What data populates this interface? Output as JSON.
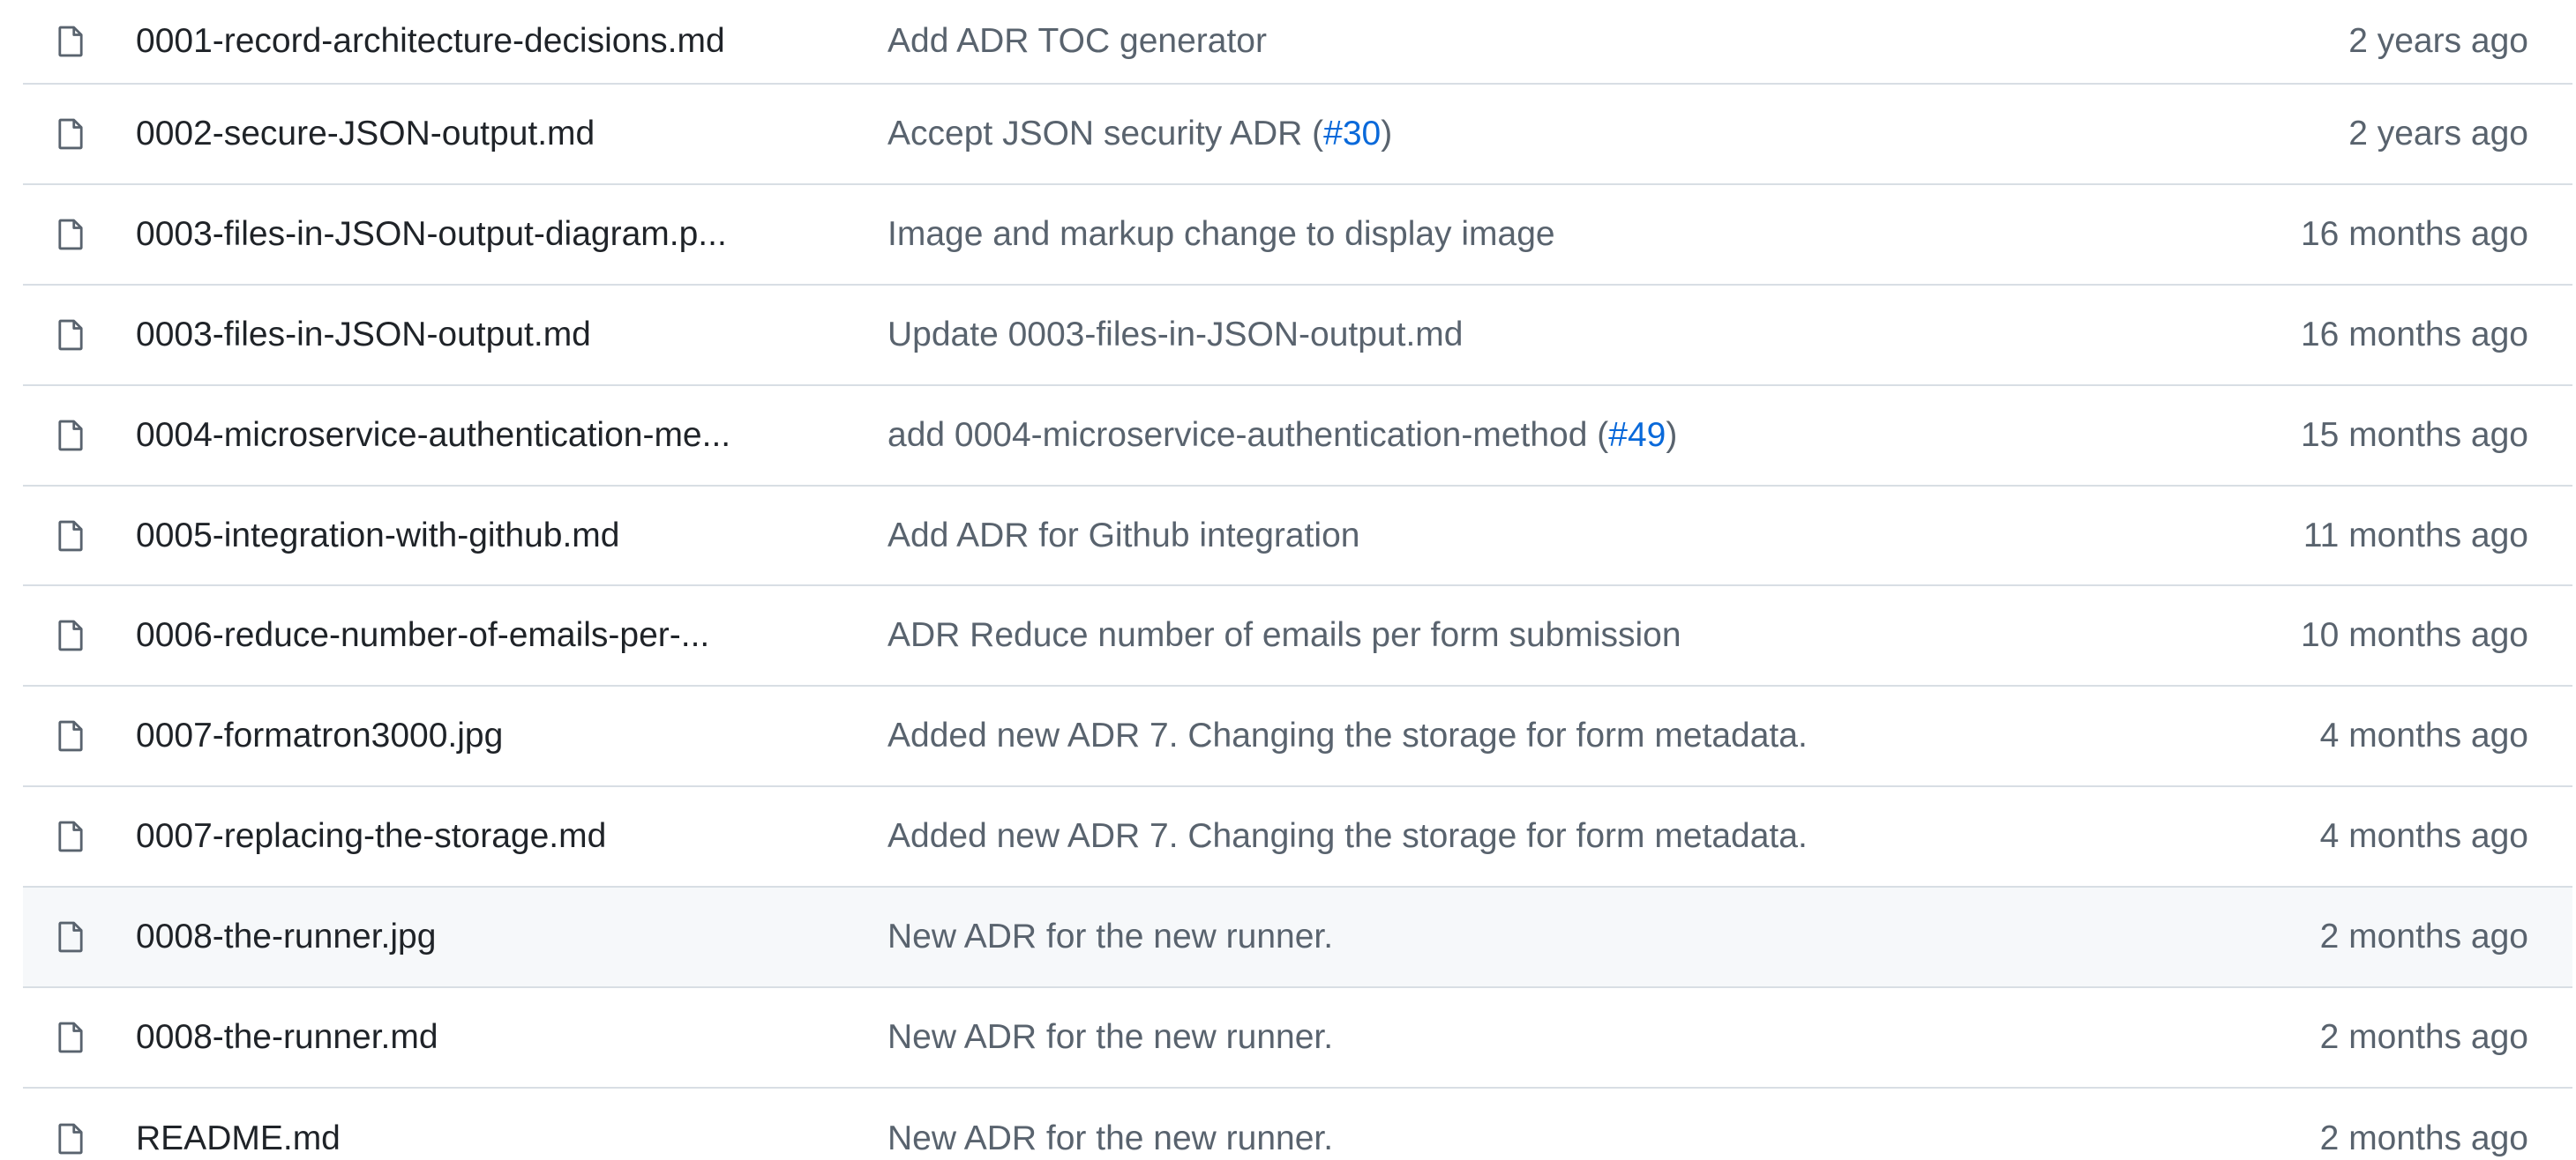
{
  "files": [
    {
      "icon": "file-icon",
      "name": "0001-record-architecture-decisions.md",
      "message": "Add ADR TOC generator",
      "pr": "",
      "message_suffix": "",
      "age": "2 years ago"
    },
    {
      "icon": "file-icon",
      "name": "0002-secure-JSON-output.md",
      "message": "Accept JSON security ADR (",
      "pr": "#30",
      "message_suffix": ")",
      "age": "2 years ago"
    },
    {
      "icon": "file-icon",
      "name": "0003-files-in-JSON-output-diagram.p...",
      "message": "Image and markup change to display image",
      "pr": "",
      "message_suffix": "",
      "age": "16 months ago"
    },
    {
      "icon": "file-icon",
      "name": "0003-files-in-JSON-output.md",
      "message": "Update 0003-files-in-JSON-output.md",
      "pr": "",
      "message_suffix": "",
      "age": "16 months ago"
    },
    {
      "icon": "file-icon",
      "name": "0004-microservice-authentication-me...",
      "message": "add 0004-microservice-authentication-method (",
      "pr": "#49",
      "message_suffix": ")",
      "age": "15 months ago"
    },
    {
      "icon": "file-icon",
      "name": "0005-integration-with-github.md",
      "message": "Add ADR for Github integration",
      "pr": "",
      "message_suffix": "",
      "age": "11 months ago"
    },
    {
      "icon": "file-icon",
      "name": "0006-reduce-number-of-emails-per-...",
      "message": "ADR Reduce number of emails per form submission",
      "pr": "",
      "message_suffix": "",
      "age": "10 months ago"
    },
    {
      "icon": "file-icon",
      "name": "0007-formatron3000.jpg",
      "message": "Added new ADR 7. Changing the storage for form metadata.",
      "pr": "",
      "message_suffix": "",
      "age": "4 months ago"
    },
    {
      "icon": "file-icon",
      "name": "0007-replacing-the-storage.md",
      "message": "Added new ADR 7. Changing the storage for form metadata.",
      "pr": "",
      "message_suffix": "",
      "age": "4 months ago"
    },
    {
      "icon": "file-icon",
      "name": "0008-the-runner.jpg",
      "message": "New ADR for the new runner.",
      "pr": "",
      "message_suffix": "",
      "age": "2 months ago",
      "hovered": true
    },
    {
      "icon": "file-icon",
      "name": "0008-the-runner.md",
      "message": "New ADR for the new runner.",
      "pr": "",
      "message_suffix": "",
      "age": "2 months ago"
    },
    {
      "icon": "file-icon",
      "name": "README.md",
      "message": "New ADR for the new runner.",
      "pr": "",
      "message_suffix": "",
      "age": "2 months ago"
    }
  ],
  "colors": {
    "text": "#1f2328",
    "muted": "#59636e",
    "link": "#0969da",
    "border": "#d8dee4",
    "hover_bg": "#f6f8fa"
  }
}
